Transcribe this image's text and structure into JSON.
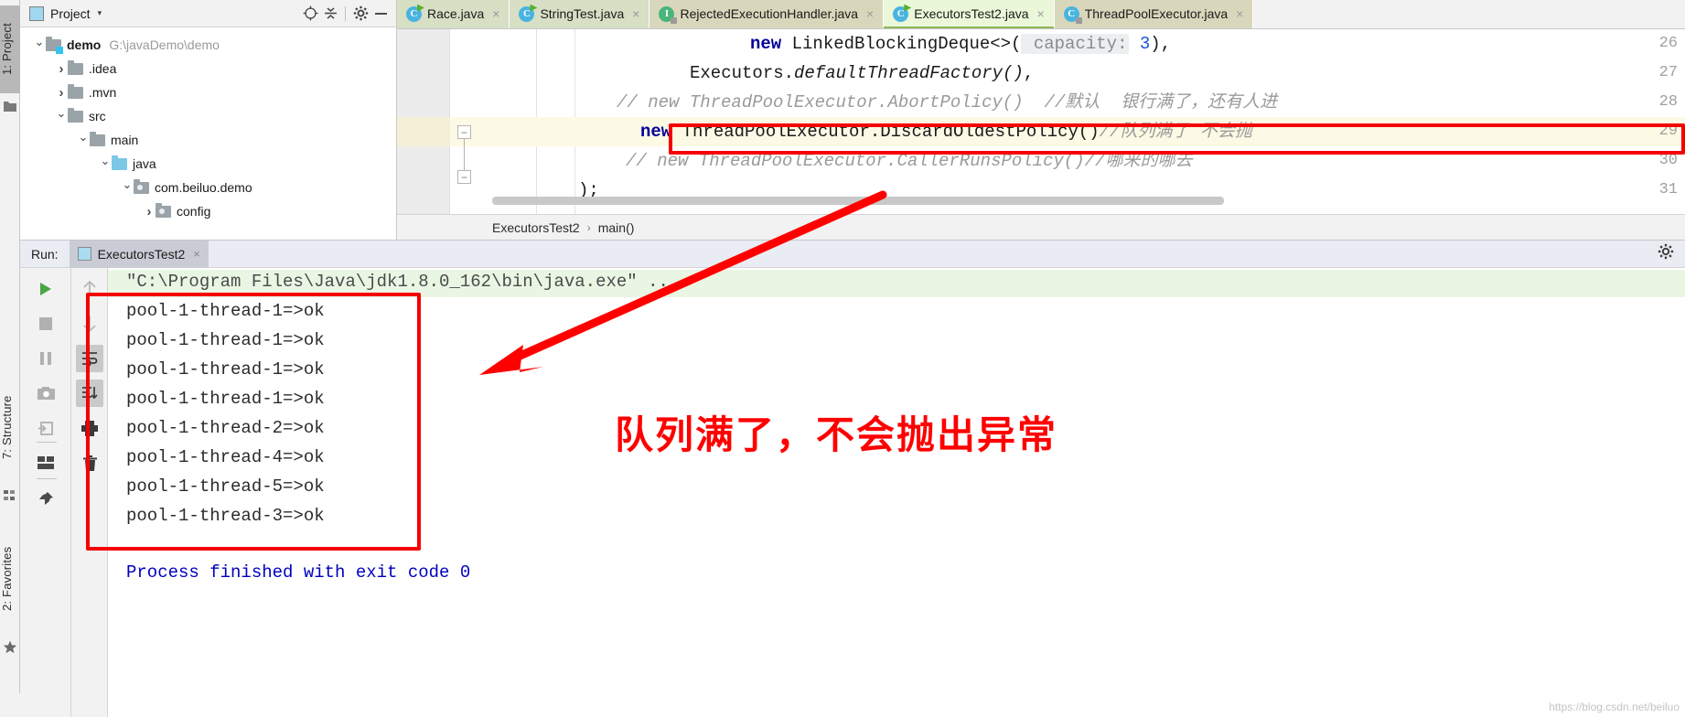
{
  "left_strip": {
    "project_tab": "1: Project",
    "structure_tab": "7: Structure",
    "favorites_tab": "2: Favorites",
    "project_icon": "folder-icon",
    "structure_icon": "structure-icon",
    "favorites_icon": "star-icon"
  },
  "project_panel": {
    "title": "Project",
    "caret": "▾",
    "toolbar": {
      "locate_icon": "crosshair-icon",
      "collapse_icon": "collapse-all-icon",
      "settings_icon": "gear-icon",
      "hide_icon": "minimize-icon"
    },
    "tree": [
      {
        "label": "demo",
        "path": "G:\\javaDemo\\demo",
        "indent": 0,
        "arrow": "open",
        "folder": "mod",
        "bold": true
      },
      {
        "label": ".idea",
        "path": "",
        "indent": 1,
        "arrow": "closed",
        "folder": "plain",
        "bold": false
      },
      {
        "label": ".mvn",
        "path": "",
        "indent": 1,
        "arrow": "closed",
        "folder": "plain",
        "bold": false
      },
      {
        "label": "src",
        "path": "",
        "indent": 1,
        "arrow": "open",
        "folder": "plain",
        "bold": false
      },
      {
        "label": "main",
        "path": "",
        "indent": 2,
        "arrow": "open",
        "folder": "plain",
        "bold": false
      },
      {
        "label": "java",
        "path": "",
        "indent": 3,
        "arrow": "open",
        "folder": "src-blue",
        "bold": false
      },
      {
        "label": "com.beiluo.demo",
        "path": "",
        "indent": 4,
        "arrow": "open",
        "folder": "pkg",
        "bold": false
      },
      {
        "label": "config",
        "path": "",
        "indent": 5,
        "arrow": "closed",
        "folder": "pkg",
        "bold": false
      }
    ]
  },
  "editor": {
    "tabs": [
      {
        "label": "Race.java",
        "icon": "class-icon",
        "kind": "class",
        "active": false,
        "style": "green"
      },
      {
        "label": "StringTest.java",
        "icon": "class-icon",
        "kind": "class",
        "active": false,
        "style": "green"
      },
      {
        "label": "RejectedExecutionHandler.java",
        "icon": "interface-icon",
        "kind": "interface-locked",
        "active": false,
        "style": "beige"
      },
      {
        "label": "ExecutorsTest2.java",
        "icon": "class-icon",
        "kind": "class",
        "active": true,
        "style": "active"
      },
      {
        "label": "ThreadPoolExecutor.java",
        "icon": "class-icon",
        "kind": "class-locked",
        "active": false,
        "style": "beige"
      }
    ],
    "close_glyph": "×",
    "line_numbers": [
      "26",
      "27",
      "28",
      "29",
      "30",
      "31"
    ],
    "lines": [
      {
        "number": "26",
        "segments": [
          {
            "text": "new ",
            "cls": "kw"
          },
          {
            "text": "LinkedBlockingDeque<>(",
            "cls": "plain"
          },
          {
            "text": " capacity:",
            "cls": "hintp"
          },
          {
            "text": " 3",
            "cls": "num"
          },
          {
            "text": "),",
            "cls": "plain"
          }
        ]
      },
      {
        "number": "27",
        "segments": [
          {
            "text": "Executors.",
            "cls": "plain"
          },
          {
            "text": "defaultThreadFactory()",
            "cls": "plain-italic"
          },
          {
            "text": ",",
            "cls": "plain"
          }
        ]
      },
      {
        "number": "28",
        "segments": [
          {
            "text": "// new ThreadPoolExecutor.AbortPolicy()  //默认  银行满了，还有人进",
            "cls": "cmt"
          }
        ]
      },
      {
        "number": "29",
        "highlighted": true,
        "segments": [
          {
            "text": "new ",
            "cls": "kw"
          },
          {
            "text": "ThreadPoolExecutor.DiscardOldestPolicy()",
            "cls": "plain"
          },
          {
            "text": "//队列满了 不会抛",
            "cls": "cmt"
          }
        ]
      },
      {
        "number": "30",
        "segments": [
          {
            "text": "// new ThreadPoolExecutor.CallerRunsPolicy()//哪来的哪去",
            "cls": "cmt"
          }
        ]
      },
      {
        "number": "31",
        "segments": [
          {
            "text": ");",
            "cls": "plain"
          }
        ]
      }
    ],
    "breadcrumb": {
      "class_name": "ExecutorsTest2",
      "separator": "›",
      "method_name": "main()"
    }
  },
  "run_panel": {
    "label": "Run:",
    "tab_name": "ExecutorsTest2",
    "tab_close": "×",
    "settings_icon": "gear-icon",
    "toolbar_left": [
      {
        "name": "rerun-button",
        "icon": "play-icon"
      },
      {
        "name": "stop-button",
        "icon": "stop-icon"
      },
      {
        "name": "pause-button",
        "icon": "pause-icon"
      },
      {
        "name": "dump-threads-button",
        "icon": "camera-icon"
      },
      {
        "name": "restore-layout-button",
        "icon": "restore-icon"
      },
      {
        "name": "layout-settings-button",
        "icon": "layout-icon"
      },
      {
        "name": "pin-tab-button",
        "icon": "pin-icon"
      }
    ],
    "toolbar_right": [
      {
        "name": "scroll-up-button",
        "icon": "arrow-up-icon"
      },
      {
        "name": "scroll-down-button",
        "icon": "arrow-down-icon"
      },
      {
        "name": "soft-wrap-button",
        "icon": "soft-wrap-icon"
      },
      {
        "name": "scroll-to-end-button",
        "icon": "scroll-end-icon"
      },
      {
        "name": "print-button",
        "icon": "printer-icon"
      },
      {
        "name": "clear-all-button",
        "icon": "trash-icon"
      }
    ],
    "console": {
      "command_line": "\"C:\\Program Files\\Java\\jdk1.8.0_162\\bin\\java.exe\" ...",
      "output": [
        "pool-1-thread-1=>ok",
        "pool-1-thread-1=>ok",
        "pool-1-thread-1=>ok",
        "pool-1-thread-1=>ok",
        "pool-1-thread-2=>ok",
        "pool-1-thread-4=>ok",
        "pool-1-thread-5=>ok",
        "pool-1-thread-3=>ok"
      ],
      "exit_line": "Process finished with exit code 0"
    }
  },
  "annotations": {
    "chinese_note": "队列满了，不会抛出异常",
    "accent_color": "#ff0000",
    "highlight_color": "#fcf9e4"
  },
  "watermark": "https://blog.csdn.net/beiluo"
}
